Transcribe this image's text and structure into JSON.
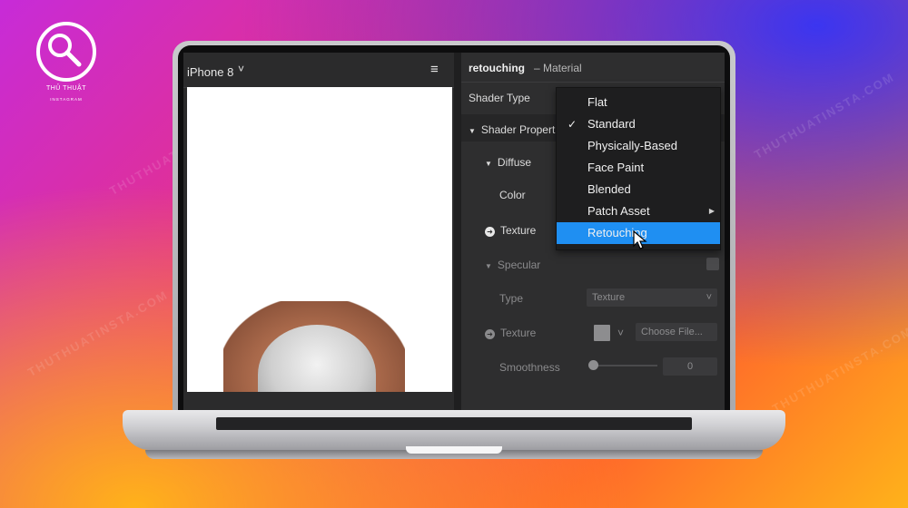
{
  "logo": {
    "title": "THỦ THUẬT",
    "subtitle": "INSTAGRAM",
    "icon": "search-magnifier-icon"
  },
  "watermark": "THUTHUATINSTA.COM",
  "preview": {
    "device": "iPhone 8",
    "device_chevron": "˅",
    "menu_icon": "≡"
  },
  "inspector": {
    "title": "retouching",
    "subtitle": "– Material",
    "shader_type_label": "Shader Type",
    "shader_properties_label": "Shader Properti",
    "diffuse_label": "Diffuse",
    "color_label": "Color",
    "texture_label": "Texture",
    "specular_label": "Specular",
    "type_label": "Type",
    "type_value": "Texture",
    "specular_texture_label": "Texture",
    "choose_file_label": "Choose File...",
    "smoothness_label": "Smoothness",
    "smoothness_value": "0"
  },
  "shader_menu": {
    "items": [
      {
        "label": "Flat",
        "checked": false
      },
      {
        "label": "Standard",
        "checked": true
      },
      {
        "label": "Physically-Based",
        "checked": false
      },
      {
        "label": "Face Paint",
        "checked": false
      },
      {
        "label": "Blended",
        "checked": false
      },
      {
        "label": "Patch Asset",
        "checked": false,
        "submenu": true
      },
      {
        "label": "Retouching",
        "checked": false,
        "highlighted": true
      }
    ]
  },
  "colors": {
    "highlight": "#1f8ff2",
    "panel": "#2e2e2f"
  }
}
